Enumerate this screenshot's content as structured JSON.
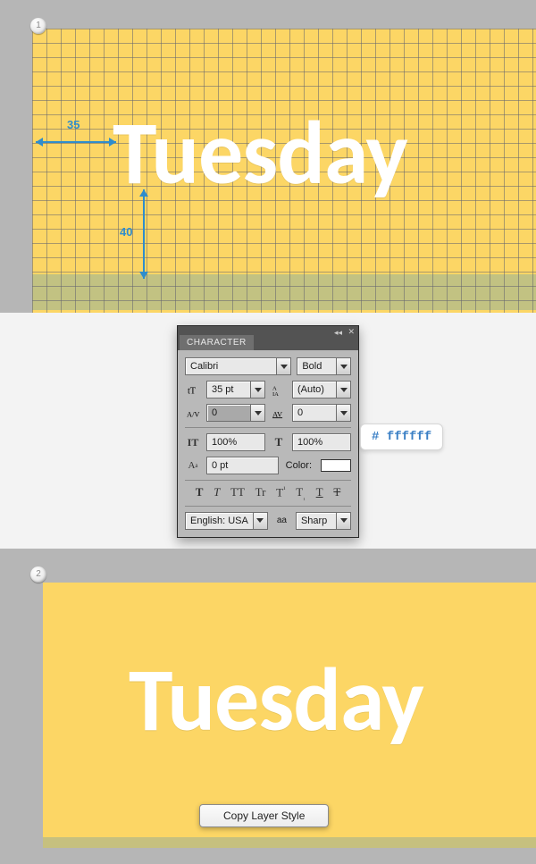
{
  "section1": {
    "step_badge": "1",
    "day_text": "Tuesday",
    "measure_horizontal": "35",
    "measure_vertical": "40"
  },
  "character_panel": {
    "tab_label": "CHARACTER",
    "font_family": "Calibri",
    "font_style": "Bold",
    "font_size": "35 pt",
    "leading": "(Auto)",
    "kerning": "0",
    "tracking": "0",
    "vertical_scale": "100%",
    "horizontal_scale": "100%",
    "baseline_shift": "0 pt",
    "color_label": "Color:",
    "language": "English: USA",
    "antialias_prefix": "aa",
    "antialias": "Sharp"
  },
  "color_callout": "# ffffff",
  "section3": {
    "step_badge": "2",
    "day_text": "Tuesday",
    "context_menu_item": "Copy Layer Style"
  }
}
